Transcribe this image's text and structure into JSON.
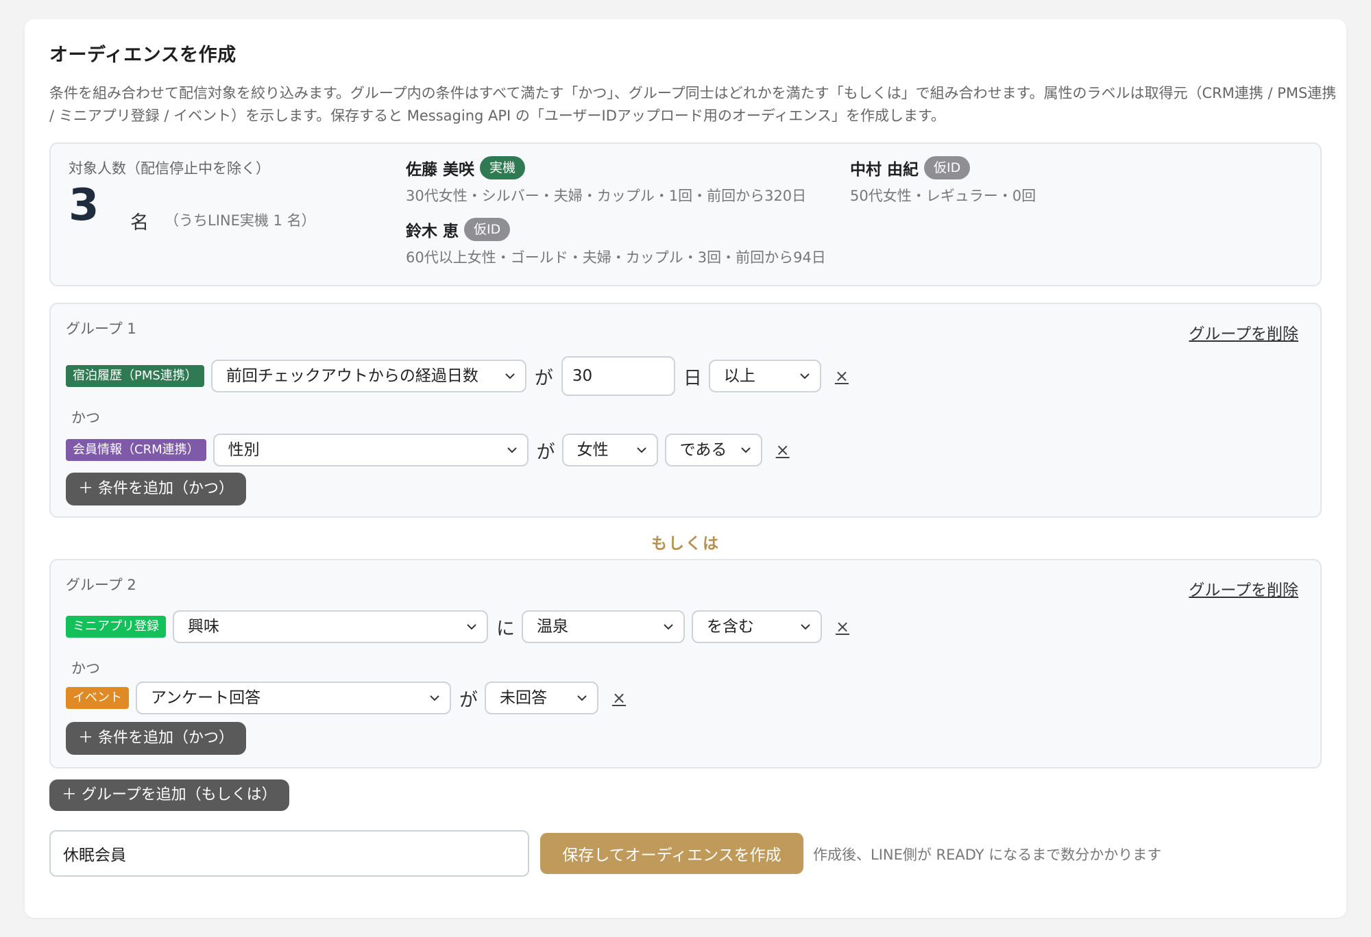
{
  "title": "オーディエンスを作成",
  "description": "条件を組み合わせて配信対象を絞り込みます。グループ内の条件はすべて満たす「かつ」、グループ同士はどれかを満たす「もしくは」で組み合わせます。属性のラベルは取得元（CRM連携 / PMS連携 / ミニアプリ登録 / イベント）を示します。保存すると Messaging API の「ユーザーIDアップロード用のオーディエンス」を作成します。",
  "summary": {
    "label": "対象人数（配信停止中を除く）",
    "count": "3",
    "unit": "名",
    "sub": "（うちLINE実機 1 名）",
    "members": [
      {
        "name": "佐藤 美咲",
        "badge": "実機",
        "detail": "30代女性・シルバー・夫婦・カップル・1回・前回から320日"
      },
      {
        "name": "中村 由紀",
        "badge": "仮ID",
        "detail": "50代女性・レギュラー・0回"
      },
      {
        "name": "鈴木 恵",
        "badge": "仮ID",
        "detail": "60代以上女性・ゴールド・夫婦・カップル・3回・前回から94日"
      }
    ]
  },
  "colors": {
    "pms": "#2f7a52",
    "crm": "#7e5aa8",
    "miniapp": "#13c05a",
    "event": "#e08a25",
    "accent": "#bf9a5b"
  },
  "groups": [
    {
      "title": "グループ 1",
      "delete_label": "グループを削除",
      "and_label": "かつ",
      "add_label": "＋ 条件を追加（かつ）",
      "conditions": [
        {
          "tag": "宿泊履歴（PMS連携）",
          "field": "前回チェックアウトからの経過日数",
          "particle": "が",
          "value": "30",
          "unit": "日",
          "op": "以上",
          "remove": "×"
        },
        {
          "tag": "会員情報（CRM連携）",
          "field": "性別",
          "particle": "が",
          "value": "女性",
          "op": "である",
          "remove": "×"
        }
      ]
    },
    {
      "title": "グループ 2",
      "delete_label": "グループを削除",
      "and_label": "かつ",
      "add_label": "＋ 条件を追加（かつ）",
      "conditions": [
        {
          "tag": "ミニアプリ登録",
          "field": "興味",
          "particle": "に",
          "value": "温泉",
          "op": "を含む",
          "remove": "×"
        },
        {
          "tag": "イベント",
          "field": "アンケート回答",
          "particle": "が",
          "value": "未回答",
          "remove": "×"
        }
      ]
    }
  ],
  "or_label": "もしくは",
  "add_group_label": "＋ グループを追加（もしくは）",
  "audience_name": "休眠会員",
  "save_label": "保存してオーディエンスを作成",
  "save_note": "作成後、LINE側が READY になるまで数分かかります"
}
